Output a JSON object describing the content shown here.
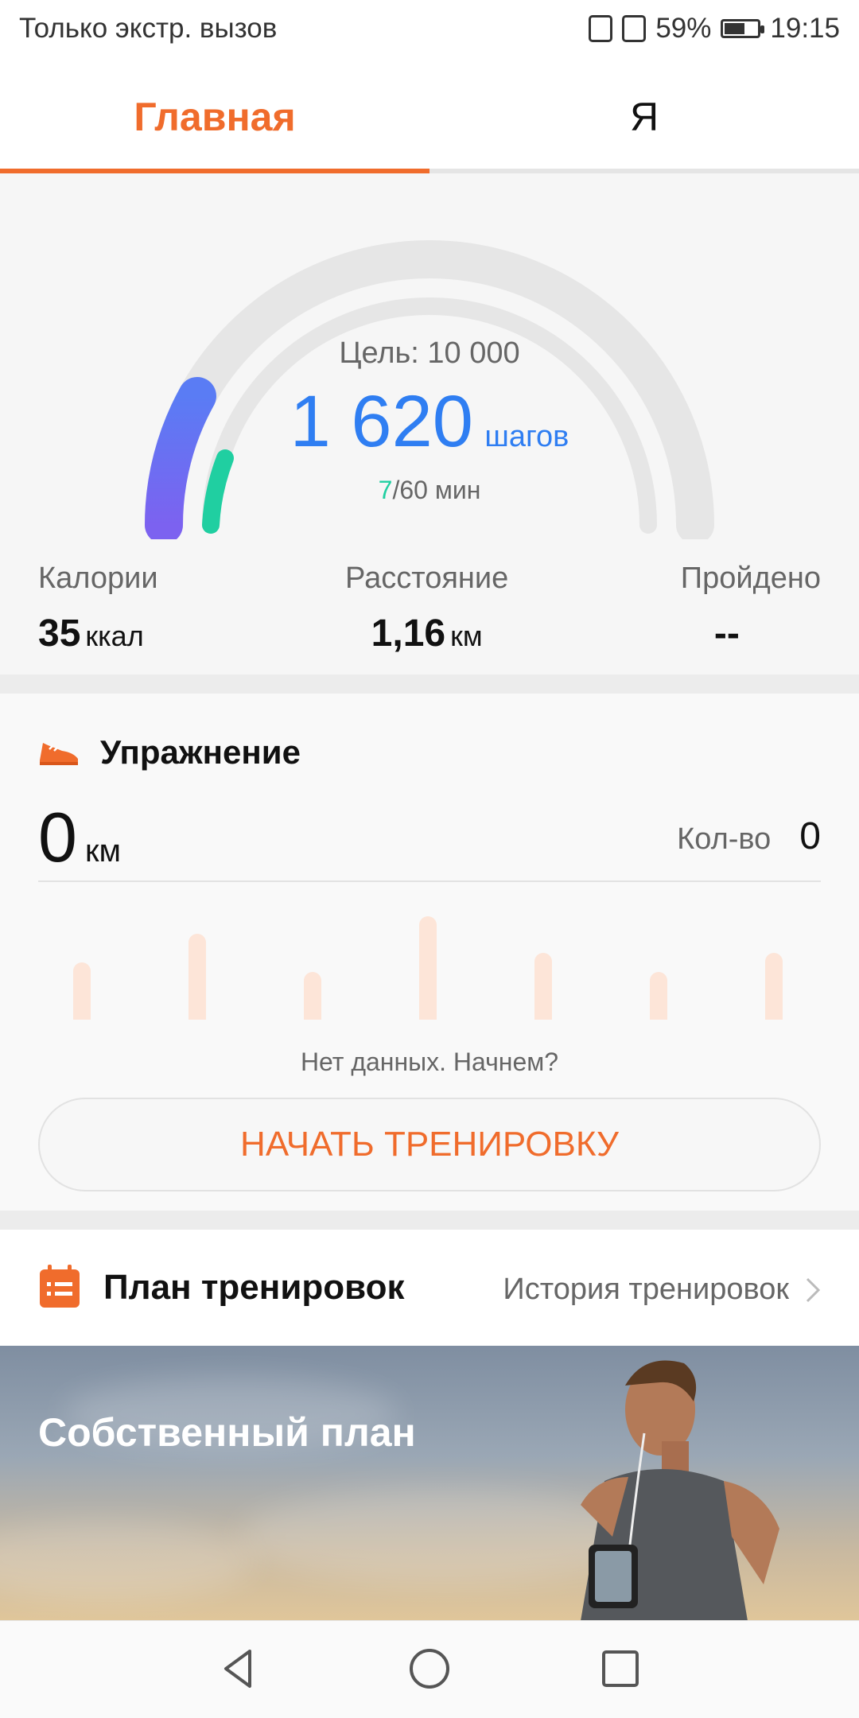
{
  "status_bar": {
    "left_text": "Только экстр. вызов",
    "battery": "59%",
    "time": "19:15"
  },
  "tabs": [
    {
      "label": "Главная",
      "active": true
    },
    {
      "label": "Я",
      "active": false
    }
  ],
  "steps": {
    "goal_label": "Цель: 10 000",
    "value": "1 620",
    "unit": "шагов",
    "active_minutes": "7",
    "minutes_rest": "/60 мин"
  },
  "stats": {
    "calories": {
      "label": "Калории",
      "value": "35",
      "unit": "ккал"
    },
    "distance": {
      "label": "Расстояние",
      "value": "1,16",
      "unit": "км"
    },
    "passed": {
      "label": "Пройдено",
      "value": "--"
    }
  },
  "exercise": {
    "title": "Упражнение",
    "km_value": "0",
    "km_unit": "км",
    "count_label": "Кол-во",
    "count_value": "0",
    "no_data": "Нет данных. Начнем?",
    "start_button": "НАЧАТЬ ТРЕНИРОВКУ"
  },
  "plan": {
    "title": "План тренировок",
    "history_link": "История тренировок"
  },
  "banner": {
    "title": "Собственный план"
  },
  "colors": {
    "accent": "#f06c2c",
    "steps_blue": "#2f7ef2",
    "minutes_green": "#20cfa1"
  }
}
